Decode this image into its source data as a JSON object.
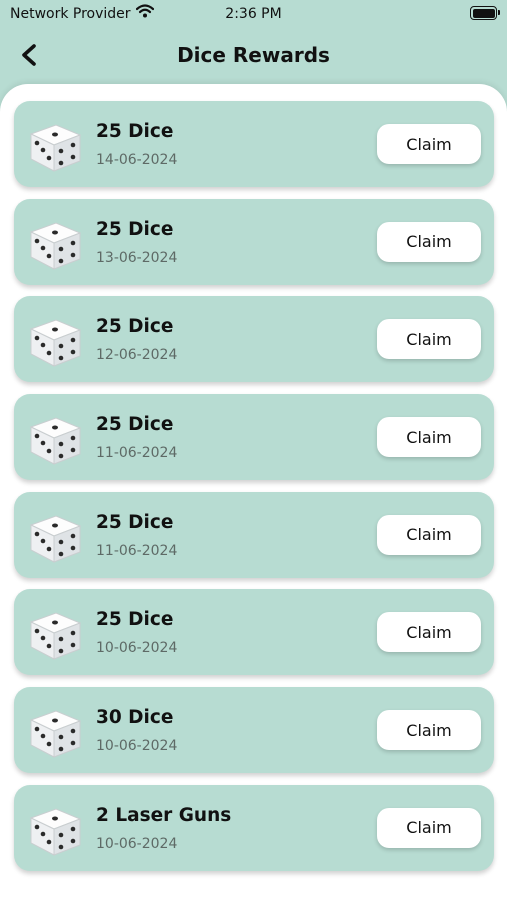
{
  "status_bar": {
    "carrier": "Network Provider",
    "time": "2:36 PM"
  },
  "header": {
    "title": "Dice Rewards",
    "back_icon": "chevron-left-icon"
  },
  "rewards": [
    {
      "name": "25 Dice",
      "date": "14-06-2024",
      "button": "Claim"
    },
    {
      "name": "25 Dice",
      "date": "13-06-2024",
      "button": "Claim"
    },
    {
      "name": "25 Dice",
      "date": "12-06-2024",
      "button": "Claim"
    },
    {
      "name": "25 Dice",
      "date": "11-06-2024",
      "button": "Claim"
    },
    {
      "name": "25 Dice",
      "date": "11-06-2024",
      "button": "Claim"
    },
    {
      "name": "25 Dice",
      "date": "10-06-2024",
      "button": "Claim"
    },
    {
      "name": "30 Dice",
      "date": "10-06-2024",
      "button": "Claim"
    },
    {
      "name": "2 Laser Guns",
      "date": "10-06-2024",
      "button": "Claim"
    }
  ],
  "colors": {
    "background": "#b7dcd2",
    "card": "#b7dcd2",
    "button": "#ffffff"
  }
}
